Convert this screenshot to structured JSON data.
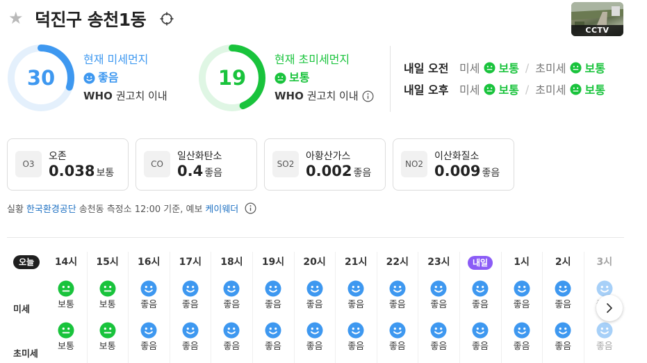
{
  "header": {
    "title": "덕진구 송천1동",
    "cctv_label": "CCTV"
  },
  "pm10": {
    "value": "30",
    "title": "현재 미세먼지",
    "status": "좋음",
    "who": "WHO",
    "who_text": "권고치 이내",
    "gauge_fraction": 0.3,
    "color": "#3e98f0"
  },
  "pm25": {
    "value": "19",
    "title": "현재 초미세먼지",
    "status": "보통",
    "who": "WHO",
    "who_text": "권고치 이내",
    "gauge_fraction": 0.44,
    "color": "#19c33c"
  },
  "tomorrow": [
    {
      "label": "내일 오전",
      "pm10_key": "미세",
      "pm10_status": "보통",
      "pm25_key": "초미세",
      "pm25_status": "보통"
    },
    {
      "label": "내일 오후",
      "pm10_key": "미세",
      "pm10_status": "보통",
      "pm25_key": "초미세",
      "pm25_status": "보통"
    }
  ],
  "pollutants": [
    {
      "code": "O3",
      "name": "오존",
      "value": "0.038",
      "status": "보통"
    },
    {
      "code": "CO",
      "name": "일산화탄소",
      "value": "0.4",
      "status": "좋음"
    },
    {
      "code": "SO2",
      "name": "아황산가스",
      "value": "0.002",
      "status": "좋음"
    },
    {
      "code": "NO2",
      "name": "이산화질소",
      "value": "0.009",
      "status": "좋음"
    }
  ],
  "source": {
    "prefix": "실황",
    "org": "한국환경공단",
    "middle": "송천동 측정소 12:00 기준, 예보",
    "forecast_org": "케이웨더"
  },
  "hourly": {
    "today_label": "오늘",
    "row_pm10": "미세",
    "row_pm25": "초미세",
    "hours": [
      {
        "label": "14시",
        "pm10": "보통",
        "pm25": "보통"
      },
      {
        "label": "15시",
        "pm10": "보통",
        "pm25": "보통"
      },
      {
        "label": "16시",
        "pm10": "좋음",
        "pm25": "좋음"
      },
      {
        "label": "17시",
        "pm10": "좋음",
        "pm25": "좋음"
      },
      {
        "label": "18시",
        "pm10": "좋음",
        "pm25": "좋음"
      },
      {
        "label": "19시",
        "pm10": "좋음",
        "pm25": "좋음"
      },
      {
        "label": "20시",
        "pm10": "좋음",
        "pm25": "좋음"
      },
      {
        "label": "21시",
        "pm10": "좋음",
        "pm25": "좋음"
      },
      {
        "label": "22시",
        "pm10": "좋음",
        "pm25": "좋음"
      },
      {
        "label": "23시",
        "pm10": "좋음",
        "pm25": "좋음"
      },
      {
        "label": "내일",
        "pm10": "좋음",
        "pm25": "좋음",
        "badge": true
      },
      {
        "label": "1시",
        "pm10": "좋음",
        "pm25": "좋음"
      },
      {
        "label": "2시",
        "pm10": "좋음",
        "pm25": "좋음"
      },
      {
        "label": "3시",
        "pm10": "좋음",
        "pm25": "좋음",
        "faded": true
      }
    ]
  },
  "colors": {
    "good": "#3e98f0",
    "normal": "#19c33c",
    "tomorrow_badge": "#8b5cf6"
  }
}
